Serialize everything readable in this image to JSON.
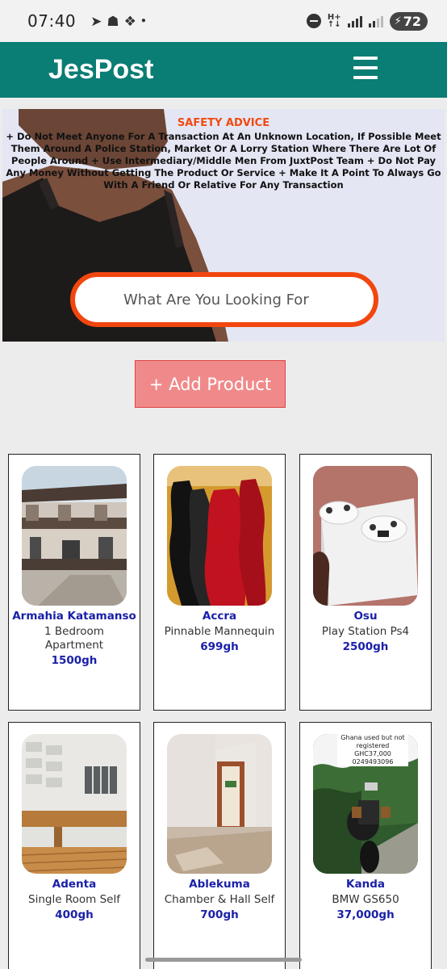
{
  "status_bar": {
    "time": "07:40",
    "network_label_top": "H+",
    "network_label_bottom": "↑↓",
    "battery": "72"
  },
  "header": {
    "brand": "JesPost"
  },
  "hero": {
    "safety_title": "SAFETY ADVICE",
    "safety_text": "+ Do Not Meet Anyone For A Transaction At An Unknown Location, If Possible Meet Them Around A Police Station, Market Or A Lorry Station Where There Are Lot Of People Around + Use Intermediary/Middle Men From JuxtPost Team + Do Not Pay Any Money Without Getting The Product Or Service + Make It A Point To Always Go With A Friend Or Relative For Any Transaction",
    "search_placeholder": "What Are You Looking For"
  },
  "add_product_label": "+ Add Product",
  "products": [
    {
      "location": "Armahia Katamanso",
      "title": "1 Bedroom Apartment",
      "price": "1500gh"
    },
    {
      "location": "Accra",
      "title": "Pinnable Mannequin",
      "price": "699gh"
    },
    {
      "location": "Osu",
      "title": "Play Station Ps4",
      "price": "2500gh"
    },
    {
      "location": "Adenta",
      "title": "Single Room Self",
      "price": "400gh"
    },
    {
      "location": "Ablekuma",
      "title": "Chamber & Hall Self",
      "price": "700gh"
    },
    {
      "location": "Kanda",
      "title": "BMW GS650",
      "price": "37,000gh",
      "image_caption": [
        "Ghana used but not",
        "registered",
        "GHC37,000",
        "0249493096"
      ]
    }
  ]
}
